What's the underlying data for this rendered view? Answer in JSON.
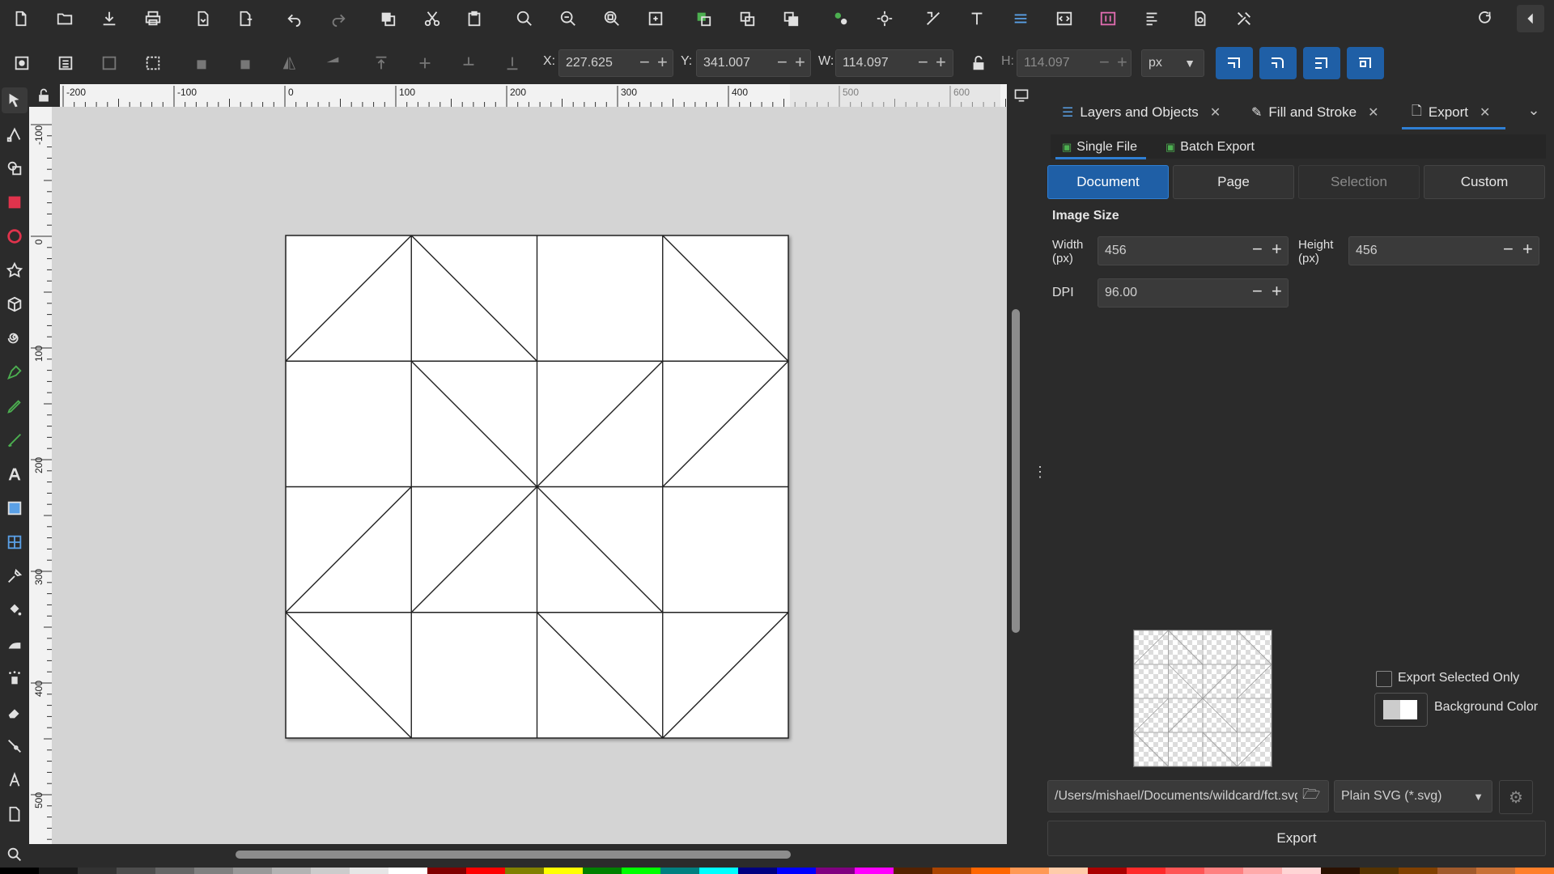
{
  "toolbar": {
    "x_label": "X:",
    "x_value": "227.625",
    "y_label": "Y:",
    "y_value": "341.007",
    "w_label": "W:",
    "w_value": "114.097",
    "h_label": "H:",
    "h_value": "114.097",
    "unit": "px"
  },
  "ruler": {
    "top_ticks": [
      "-200",
      "-100",
      "0",
      "100",
      "200",
      "300",
      "400",
      "500",
      "600"
    ],
    "left_ticks": [
      "-100",
      "0",
      "100",
      "200",
      "300",
      "400",
      "500"
    ]
  },
  "dock": {
    "tabs": [
      {
        "label": "Layers and Objects"
      },
      {
        "label": "Fill and Stroke"
      },
      {
        "label": "Export"
      }
    ]
  },
  "export": {
    "subtabs": [
      "Single File",
      "Batch Export"
    ],
    "area_buttons": [
      "Document",
      "Page",
      "Selection",
      "Custom"
    ],
    "image_size_heading": "Image Size",
    "width_label": "Width\n(px)",
    "width_value": "456",
    "height_label": "Height\n(px)",
    "height_value": "456",
    "dpi_label": "DPI",
    "dpi_value": "96.00",
    "export_selected_only": "Export Selected Only",
    "background_color": "Background Color",
    "file_path": "/Users/mishael/Documents/wildcard/fct.svg",
    "format": "Plain SVG (*.svg)",
    "export_button": "Export"
  },
  "colors": {
    "accent": "#1f5fa6",
    "bg": "#2b2b2b",
    "canvas": "#d4d4d4"
  }
}
